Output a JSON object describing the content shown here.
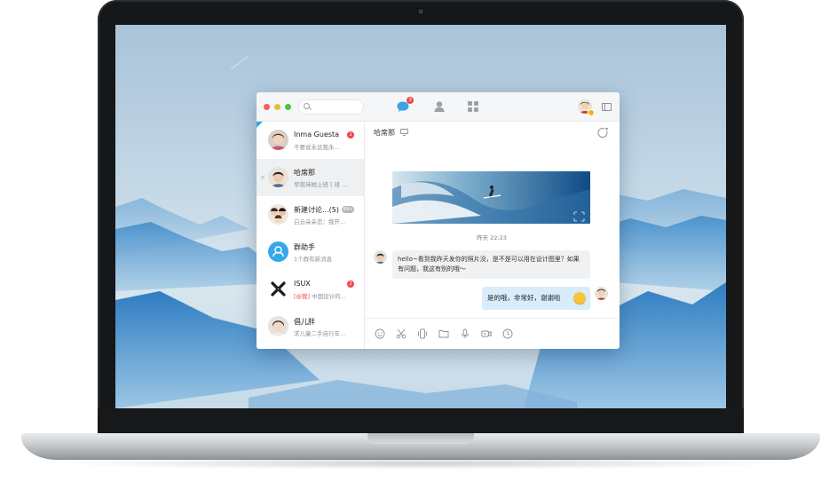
{
  "colors": {
    "accent": "#3aa3e8",
    "badge": "#f2434a",
    "traffic_red": "#fc5b57",
    "traffic_yellow": "#e5bf3c",
    "traffic_green": "#57c038",
    "outgoing_bubble": "#d8ecfb",
    "incoming_bubble": "#f0f1f3"
  },
  "titlebar": {
    "search_placeholder": "",
    "chat_badge": "3",
    "icons": [
      "chat-bubble-icon",
      "contacts-icon",
      "apps-grid-icon",
      "sidebar-toggle-icon"
    ]
  },
  "conversations": [
    {
      "name": "Inma Guesta",
      "preview": "不要说永远我永...",
      "badge": "1"
    },
    {
      "name": "哈席那",
      "preview": "早就待她上班  [ 班 ...",
      "badge": ""
    },
    {
      "name": "新建讨论...(5)",
      "preview": "白云朵朵恋：我开...",
      "badge": "99+"
    },
    {
      "name": "群助手",
      "preview": "1个群有新消息",
      "badge": ""
    },
    {
      "name": "ISUX",
      "preview_mention": "[@我]",
      "preview": " 中国设计的...",
      "badge": "2"
    },
    {
      "name": "倡儿胖",
      "preview": "求儿童二手自行车...",
      "badge": ""
    }
  ],
  "chat": {
    "title": "哈席那",
    "timestamp": "昨天 22:23",
    "incoming_message": "hello~看到我昨天发你的照片没，是不是可以用在设计图里？如果有问题，我这有别的哦～",
    "outgoing_message": "是的哦，非常好，谢谢啦",
    "toolbar_icons": [
      "emoji-icon",
      "scissors-icon",
      "shake-icon",
      "folder-icon",
      "microphone-icon",
      "video-icon",
      "history-icon"
    ]
  }
}
